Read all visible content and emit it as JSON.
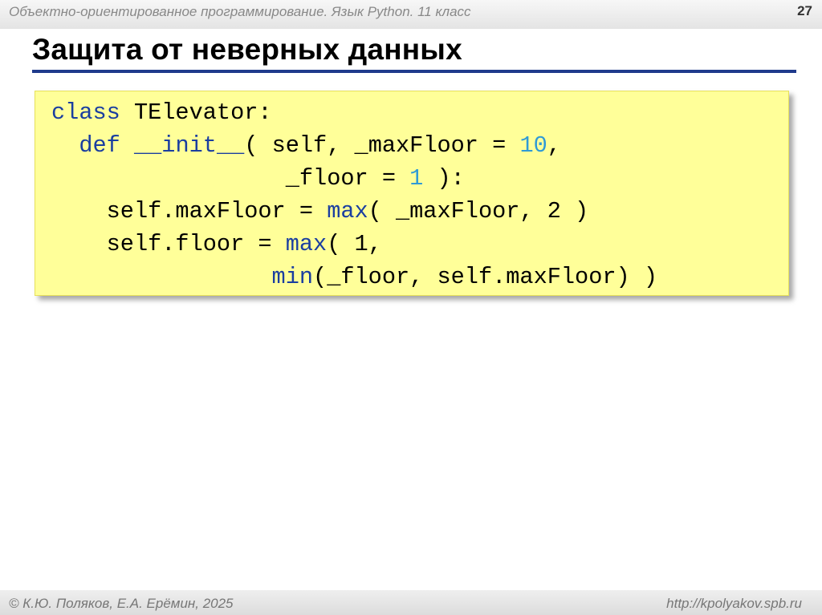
{
  "header": {
    "course": "Объектно-ориентированное программирование. Язык Python. 11 класс",
    "page_number": "27"
  },
  "slide": {
    "title": "Защита от неверных данных"
  },
  "code": {
    "l1_kw": "class",
    "l1_rest": " TElevator:",
    "l2_indent": "  ",
    "l2_kw": "def",
    "l2_sp": " ",
    "l2_fn": "__init__",
    "l2_rest": "( self, _maxFloor = ",
    "l2_num": "10",
    "l2_tail": ",",
    "l3_indent": "                 ",
    "l3_rest": "_floor = ",
    "l3_num": "1",
    "l3_tail": " ):",
    "l4_indent": "    ",
    "l4_rest": "self.maxFloor = ",
    "l4_fn": "max",
    "l4_tail": "( _maxFloor, 2 )",
    "l5_indent": "    ",
    "l5_rest": "self.floor = ",
    "l5_fn": "max",
    "l5_tail": "( 1,",
    "l6_indent": "                ",
    "l6_fn": "min",
    "l6_tail": "(_floor, self.maxFloor) )"
  },
  "footer": {
    "authors": "© К.Ю. Поляков, Е.А. Ерёмин, 2025",
    "url": "http://kpolyakov.spb.ru"
  },
  "colors": {
    "keyword": "#1a3ea0",
    "number": "#2f9ad6",
    "code_background": "#ffff99",
    "title_rule": "#1f3a8c"
  }
}
